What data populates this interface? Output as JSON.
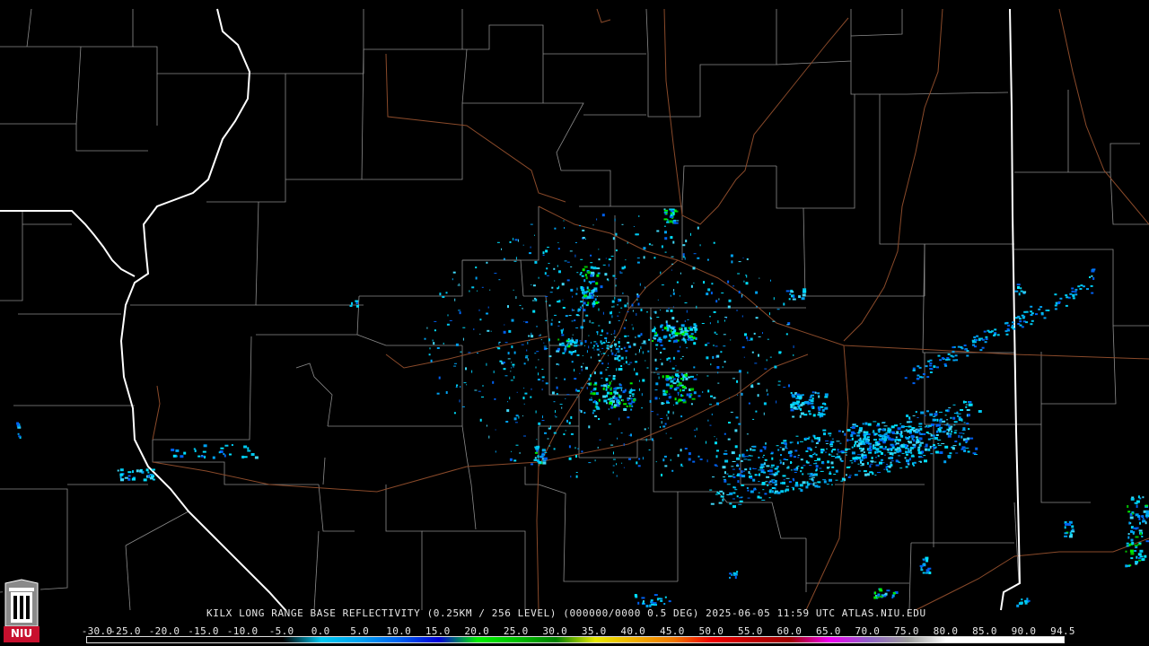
{
  "caption": "KILX LONG RANGE BASE REFLECTIVITY (0.25KM / 256 LEVEL) (000000/0000 0.5 DEG) 2025-06-05 11:59 UTC  ATLAS.NIU.EDU",
  "logo": {
    "text": "NIU",
    "icon": "university-tower-logo-icon",
    "accent": "#c8102e"
  },
  "scale": {
    "labels": [
      "-30.0",
      "-25.0",
      "-20.0",
      "-15.0",
      "-10.0",
      "-5.0",
      "0.0",
      "5.0",
      "10.0",
      "15.0",
      "20.0",
      "25.0",
      "30.0",
      "35.0",
      "40.0",
      "45.0",
      "50.0",
      "55.0",
      "60.0",
      "65.0",
      "70.0",
      "75.0",
      "80.0",
      "85.0",
      "90.0",
      "94.5"
    ],
    "colors": [
      "#000000",
      "#000000",
      "#000000",
      "#000000",
      "#000000",
      "#000000",
      "#00c8f0",
      "#00a0f0",
      "#0060f0",
      "#0000d8",
      "#00f000",
      "#00c000",
      "#008000",
      "#e8e800",
      "#f0b000",
      "#f07800",
      "#f00000",
      "#c00000",
      "#a00000",
      "#f000f0",
      "#9060c8",
      "#9c9c9c",
      "#ffffff",
      "#ffffff",
      "#ffffff",
      "#ffffff"
    ]
  }
}
